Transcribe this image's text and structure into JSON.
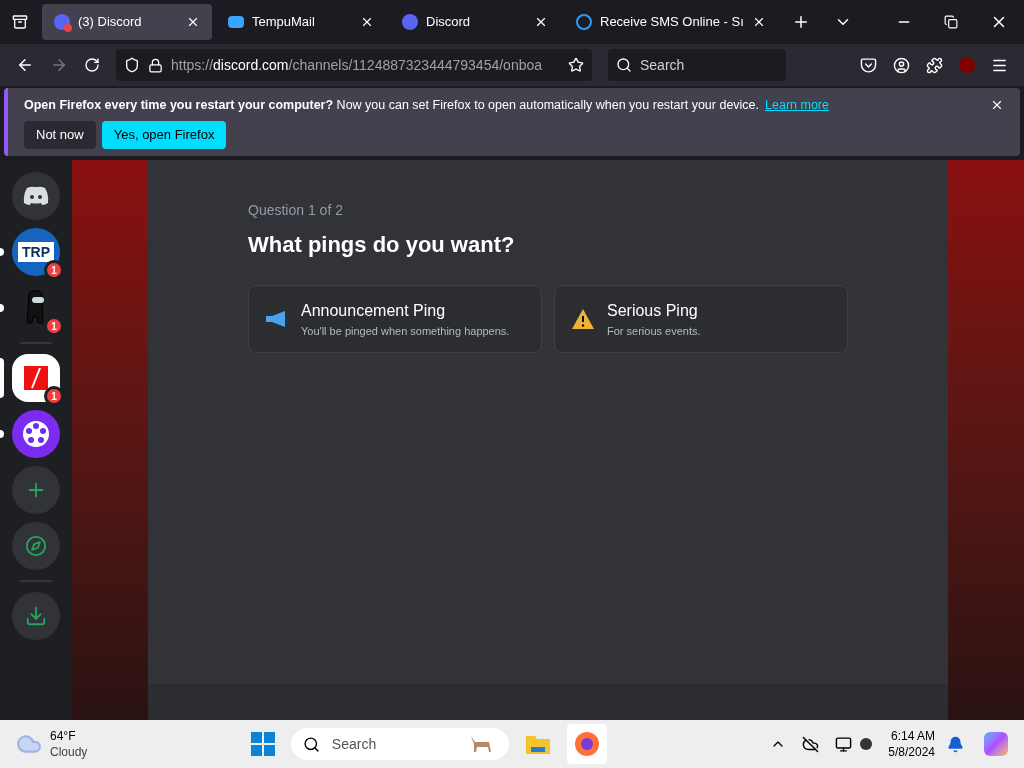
{
  "tabs": [
    {
      "title": "(3) Discord",
      "kind": "discord-badge",
      "selected": true
    },
    {
      "title": "TempuMail",
      "kind": "mail",
      "selected": false
    },
    {
      "title": "Discord",
      "kind": "discord",
      "selected": false
    },
    {
      "title": "Receive SMS Online - Sı",
      "kind": "sms",
      "selected": false
    }
  ],
  "address": {
    "prefix": "https://",
    "domain": "discord.com",
    "path": "/channels/1124887323444793454/onboa"
  },
  "search": {
    "placeholder": "Search"
  },
  "notification": {
    "bold": "Open Firefox every time you restart your computer?",
    "text": "Now you can set Firefox to open automatically when you restart your device.",
    "link": "Learn more",
    "buttons": [
      {
        "label": "Not now",
        "primary": false
      },
      {
        "label": "Yes, open Firefox",
        "primary": true
      }
    ]
  },
  "servers": [
    {
      "kind": "home",
      "selected": false
    },
    {
      "kind": "trp",
      "label": "TRP",
      "badge": "1",
      "unread": true,
      "selected": false
    },
    {
      "kind": "crewmate",
      "badge": "1",
      "unread": true,
      "selected": false
    },
    {
      "kind": "divider"
    },
    {
      "kind": "red-square",
      "badge": "1",
      "selected": true
    },
    {
      "kind": "film",
      "unread": true,
      "selected": false
    },
    {
      "kind": "add"
    },
    {
      "kind": "explore"
    },
    {
      "kind": "divider"
    },
    {
      "kind": "download"
    }
  ],
  "onboarding": {
    "step": "Question 1 of 2",
    "title": "What pings do you want?",
    "options": [
      {
        "kind": "megaphone",
        "title": "Announcement Ping",
        "description": "You'll be pinged when something happens.",
        "selected": false
      },
      {
        "kind": "warning",
        "title": "Serious Ping",
        "description": "For serious events.",
        "selected": false
      }
    ]
  },
  "taskbar": {
    "weather": {
      "temp": "64°F",
      "condition": "Cloudy"
    },
    "search": {
      "placeholder": "Search"
    },
    "time": "6:14 AM",
    "date": "5/8/2024"
  }
}
